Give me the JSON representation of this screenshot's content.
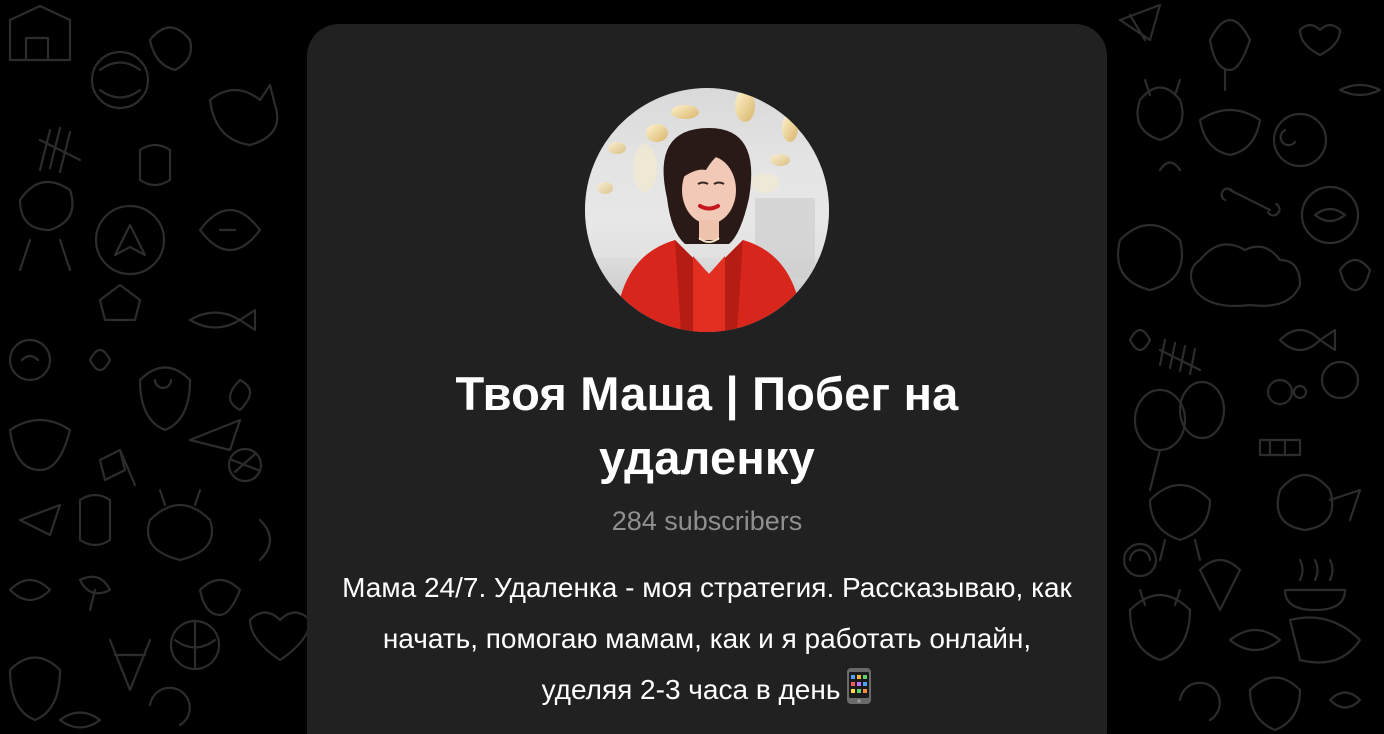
{
  "channel": {
    "title": "Твоя Маша | Побег на удаленку",
    "subscribers": "284 subscribers",
    "description": "Мама 24/7. Удаленка - моя стратегия. Рассказываю, как начать, помогаю мамам, как и я работать онлайн, уделяя 2-3 часа в день",
    "description_emoji": "mobile-phone-icon"
  },
  "colors": {
    "page_background": "#000000",
    "pattern_stroke": "#2a2a2a",
    "card_background": "#212121",
    "title_text": "#ffffff",
    "subscribers_text": "#8f8f8f",
    "avatar_outfit": "#d8261c"
  }
}
